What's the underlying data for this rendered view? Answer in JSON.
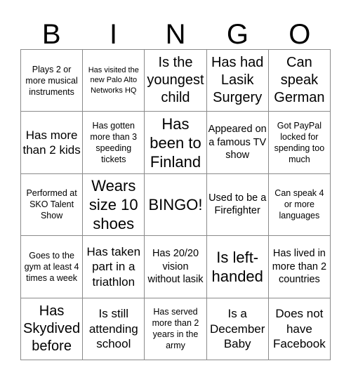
{
  "card": {
    "header_letters": [
      "B",
      "I",
      "N",
      "G",
      "O"
    ],
    "free_space_label": "BINGO!",
    "colors": {
      "background": "#ffffff",
      "text": "#000000",
      "grid_line": "#8a8a8a"
    },
    "rows": [
      [
        {
          "text": "Plays 2 or more musical instruments",
          "size": "sm"
        },
        {
          "text": "Has visited the new Palo Alto Networks HQ",
          "size": "xs"
        },
        {
          "text": "Is the youngest child",
          "size": "xl"
        },
        {
          "text": "Has had Lasik Surgery",
          "size": "xl"
        },
        {
          "text": "Can speak German",
          "size": "xl"
        }
      ],
      [
        {
          "text": "Has more than 2 kids",
          "size": "lg"
        },
        {
          "text": "Has gotten more than 3 speeding tickets",
          "size": "sm"
        },
        {
          "text": "Has been to Finland",
          "size": "xxl"
        },
        {
          "text": "Appeared on a famous TV show",
          "size": "md"
        },
        {
          "text": "Got PayPal locked for spending too much",
          "size": "sm"
        }
      ],
      [
        {
          "text": "Performed at SKO Talent Show",
          "size": "sm"
        },
        {
          "text": "Wears size 10 shoes",
          "size": "xxl"
        },
        {
          "text": "BINGO!",
          "size": "xxl"
        },
        {
          "text": "Used to be a Firefighter",
          "size": "md"
        },
        {
          "text": "Can speak 4 or more languages",
          "size": "sm"
        }
      ],
      [
        {
          "text": "Goes to the gym at least 4 times a week",
          "size": "sm"
        },
        {
          "text": "Has taken part in a triathlon",
          "size": "lg"
        },
        {
          "text": "Has 20/20 vision without lasik",
          "size": "md"
        },
        {
          "text": "Is left-handed",
          "size": "xxl"
        },
        {
          "text": "Has lived in more than 2 countries",
          "size": "md"
        }
      ],
      [
        {
          "text": "Has Skydived before",
          "size": "xl"
        },
        {
          "text": "Is still attending school",
          "size": "lg"
        },
        {
          "text": "Has served more than 2 years in the army",
          "size": "sm"
        },
        {
          "text": "Is a December Baby",
          "size": "lg"
        },
        {
          "text": "Does not have Facebook",
          "size": "lg"
        }
      ]
    ]
  }
}
